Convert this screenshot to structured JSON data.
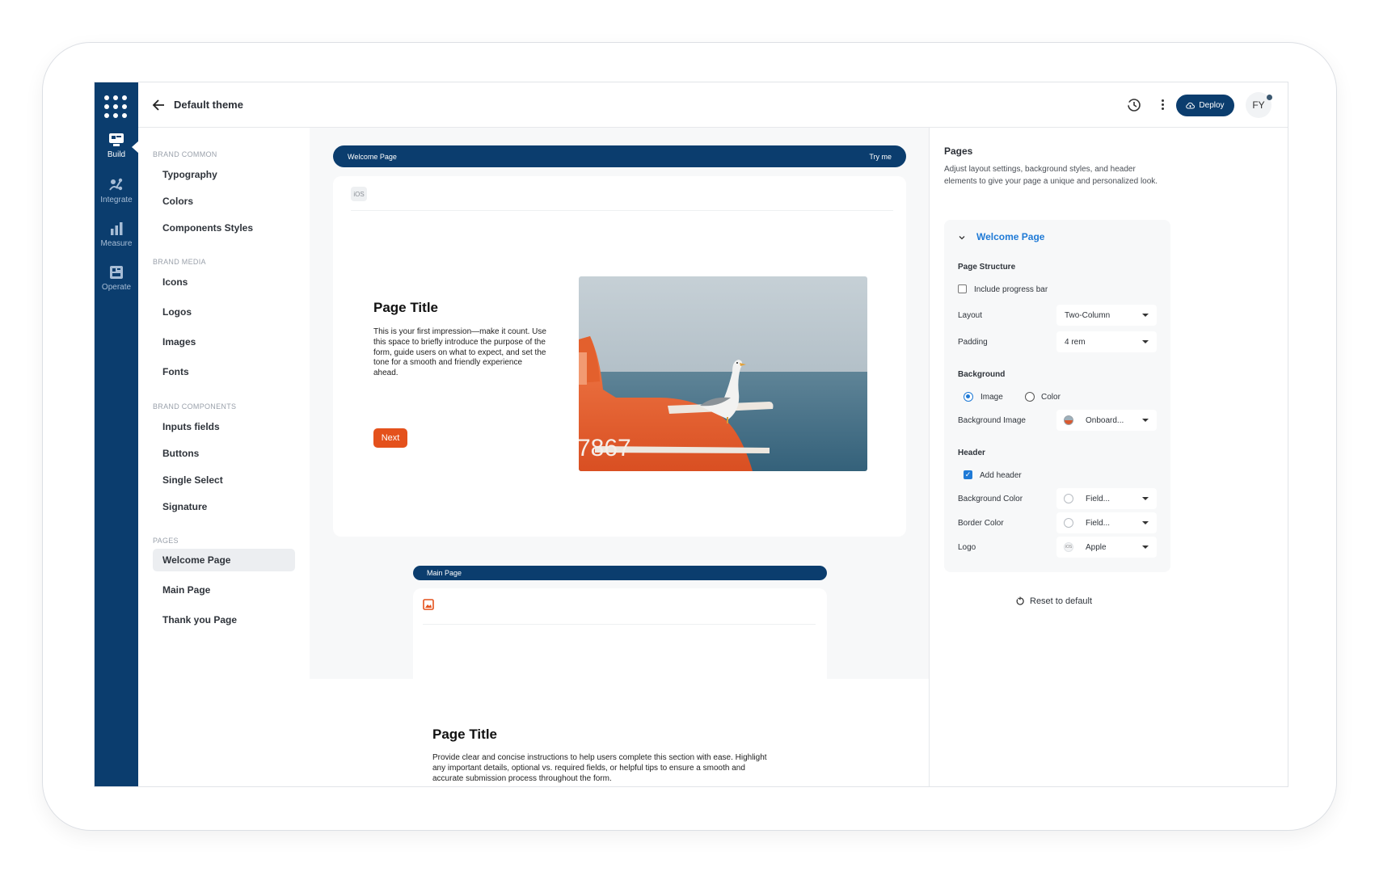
{
  "rail": {
    "items": [
      {
        "label": "Build",
        "icon": "build-icon"
      },
      {
        "label": "Integrate",
        "icon": "integrate-icon"
      },
      {
        "label": "Measure",
        "icon": "measure-icon"
      },
      {
        "label": "Operate",
        "icon": "operate-icon"
      }
    ]
  },
  "topbar": {
    "title": "Default theme",
    "deploy_label": "Deploy",
    "avatar_initials": "FY"
  },
  "leftnav": {
    "sections": [
      {
        "label": "BRAND COMMON",
        "items": [
          "Typography",
          "Colors",
          "Components Styles"
        ]
      },
      {
        "label": "BRAND MEDIA",
        "items": [
          "Icons",
          "Logos",
          "Images",
          "Fonts"
        ]
      },
      {
        "label": "BRAND COMPONENTS",
        "items": [
          "Inputs fields",
          "Buttons",
          "Single Select",
          "Signature"
        ]
      },
      {
        "label": "PAGES",
        "items": [
          "Welcome Page",
          "Main Page",
          "Thank you Page"
        ]
      }
    ],
    "active_item": "Welcome Page"
  },
  "canvas": {
    "welcome": {
      "bar_label": "Welcome Page",
      "try_me": "Try me",
      "platform_badge": "iOS",
      "page_title": "Page Title",
      "description": "This is your first impression—make it count. Use this space to briefly introduce the purpose of the form, guide users on what to expect, and set the tone for a smooth and friendly experience ahead.",
      "next_label": "Next",
      "image_text": "7867"
    },
    "main": {
      "bar_label": "Main Page",
      "page_title": "Page Title",
      "description": "Provide clear and concise instructions to help users complete this section with ease. Highlight any important details, optional vs. required fields, or helpful tips to ensure a smooth and accurate submission process throughout the form."
    }
  },
  "panel": {
    "title": "Pages",
    "description": "Adjust layout settings, background styles, and header elements to give your page a unique and personalized look.",
    "section_title": "Welcome Page",
    "page_structure_label": "Page Structure",
    "progress_bar_label": "Include progress bar",
    "progress_bar_checked": false,
    "layout_label": "Layout",
    "layout_value": "Two-Column",
    "padding_label": "Padding",
    "padding_value": "4 rem",
    "background_label": "Background",
    "bg_image_option": "Image",
    "bg_color_option": "Color",
    "bg_selected": "Image",
    "background_image_label": "Background Image",
    "background_image_value": "Onboard...",
    "header_label": "Header",
    "add_header_label": "Add header",
    "add_header_checked": true,
    "header_bg_color_label": "Background Color",
    "header_bg_color_value": "Field...",
    "border_color_label": "Border Color",
    "border_color_value": "Field...",
    "logo_label": "Logo",
    "logo_value": "Apple",
    "logo_badge": "iOS",
    "reset_label": "Reset to default"
  },
  "colors": {
    "brand_navy": "#0b3d6e",
    "accent_orange": "#e4511c",
    "link_blue": "#1f7ad6"
  }
}
